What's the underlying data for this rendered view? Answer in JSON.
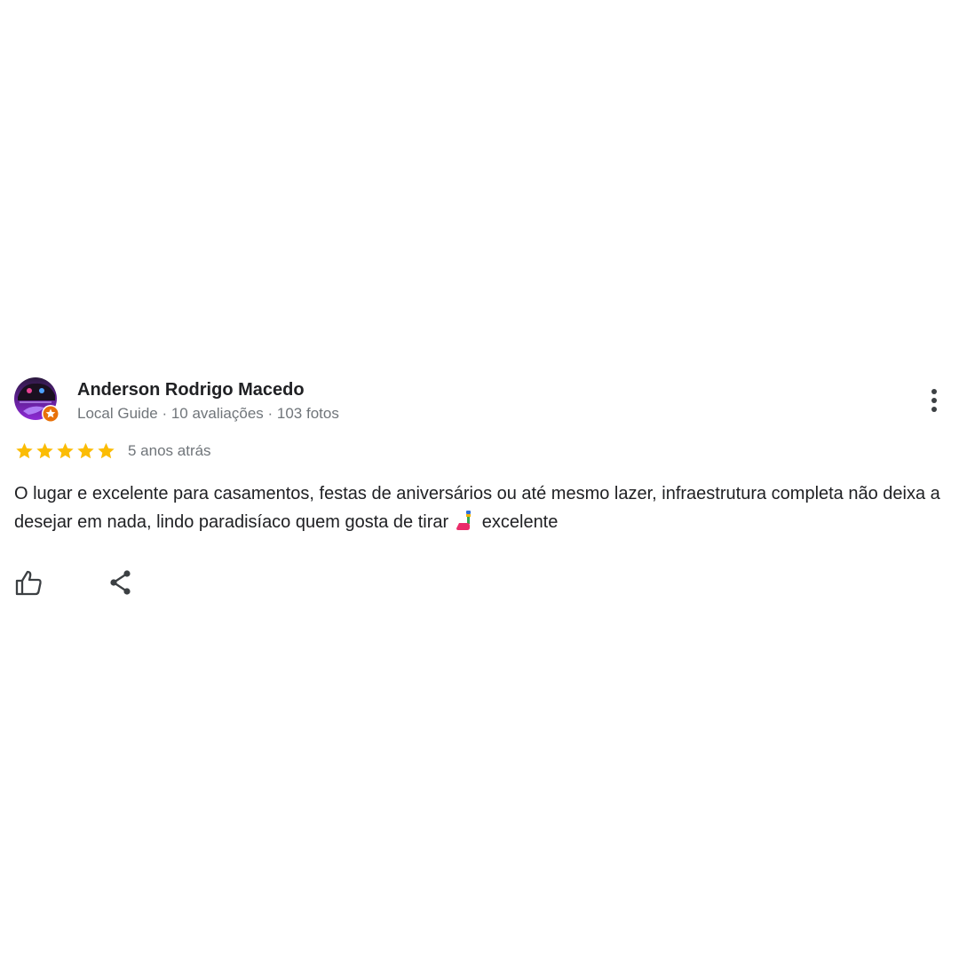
{
  "reviewer": {
    "name": "Anderson Rodrigo Macedo",
    "meta": "Local Guide · 10 avaliações · 103 fotos",
    "avatar_icon": "avatar-photo",
    "badge_icon": "local-guide-star-icon"
  },
  "rating": {
    "stars": 5,
    "max": 5,
    "color": "#fbbc04"
  },
  "date": "5 anos atrás",
  "review": {
    "text_before_emoji": "O lugar e excelente para casamentos, festas de aniversários ou até mesmo lazer, infraestrutura completa não deixa a desejar em nada, lindo paradisíaco quem gosta de tirar",
    "emoji_icon": "selfie-stick-emoji",
    "text_after_emoji": "excelente"
  },
  "actions": {
    "like_icon": "thumbs-up-icon",
    "share_icon": "share-icon",
    "more_icon": "more-vert-icon"
  },
  "colors": {
    "text_primary": "#202124",
    "text_secondary": "#70757a",
    "icon": "#3c4043",
    "badge": "#e8710a"
  }
}
